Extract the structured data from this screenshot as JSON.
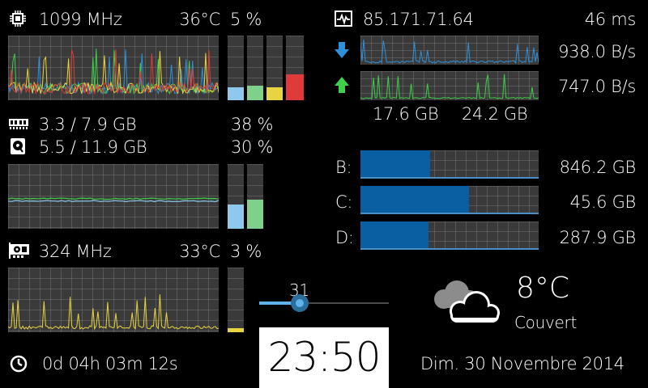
{
  "cpu": {
    "icon": "cpu-chip-icon",
    "freq": "1099 MHz",
    "temp": "36°C",
    "usage": "5 %",
    "cores": [
      {
        "level": 0.2,
        "color": "#8ec8ec"
      },
      {
        "level": 0.22,
        "color": "#7ed08a"
      },
      {
        "level": 0.2,
        "color": "#e8d341"
      },
      {
        "level": 0.4,
        "color": "#e03a3a"
      }
    ]
  },
  "ram": {
    "icon": "ram-icon",
    "value": "3.3 / 7.9 GB",
    "percent": "38 %",
    "level": 0.38,
    "color": "#8ec8ec"
  },
  "swap": {
    "icon": "disk-icon",
    "value": "5.5 / 11.9 GB",
    "percent": "30 %",
    "level": 0.45,
    "color": "#7ed08a"
  },
  "gpu": {
    "icon": "gpu-card-icon",
    "freq": "324 MHz",
    "temp": "33°C",
    "usage": "3 %",
    "level": 0.06,
    "color": "#e8d341"
  },
  "uptime": {
    "icon": "clock-icon",
    "value": "0d 04h 03m 12s"
  },
  "network": {
    "icon": "pulse-icon",
    "ip": "85.171.71.64",
    "ping": "46 ms",
    "download_icon": "arrow-down-icon",
    "download_rate": "938.0 B/s",
    "download_color": "#2f8fd8",
    "upload_icon": "arrow-up-icon",
    "upload_rate": "747.0 B/s",
    "upload_color": "#3fcf4a",
    "total_down": "17.6 GB",
    "total_up": "24.2 GB"
  },
  "disks": [
    {
      "label": "B:",
      "free": "846.2 GB",
      "used": 0.39
    },
    {
      "label": "C:",
      "free": "45.6 GB",
      "used": 0.61
    },
    {
      "label": "D:",
      "free": "287.9 GB",
      "used": 0.38
    }
  ],
  "volume": {
    "value": "31",
    "level": 0.31
  },
  "clock": {
    "time": "23:50"
  },
  "weather": {
    "icon": "cloudy-weather-icon",
    "temp": "8°C",
    "condition": "Couvert"
  },
  "date": {
    "text": "Dim. 30 Novembre 2014"
  }
}
